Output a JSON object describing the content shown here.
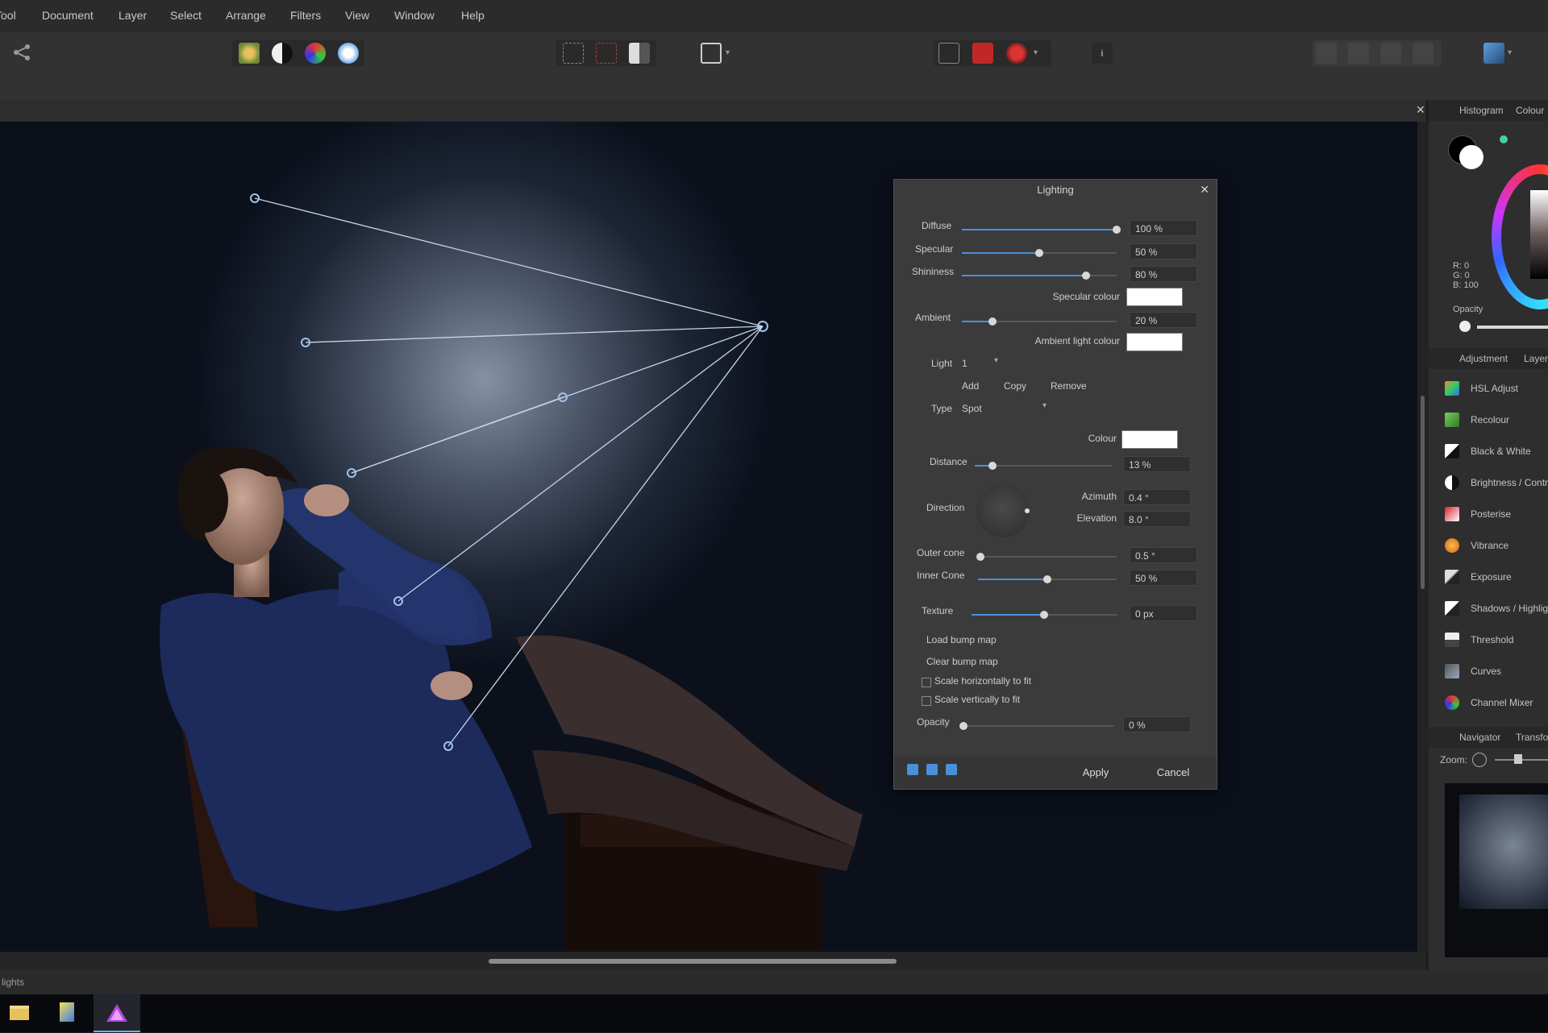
{
  "menu": [
    "Tool",
    "Document",
    "Layer",
    "Select",
    "Arrange",
    "Filters",
    "View",
    "Window",
    "Help"
  ],
  "status_text": "lights",
  "right_panel": {
    "top_tabs": [
      "Histogram",
      "Colour"
    ],
    "colour_readout": [
      "R: 0",
      "G: 0",
      "B: 100"
    ],
    "opacity_label": "Opacity",
    "mid_tabs": [
      "Adjustment",
      "Layers"
    ],
    "adjustments": [
      {
        "label": "HSL Adjust",
        "icon": "hsl-icon"
      },
      {
        "label": "Recolour",
        "icon": "recolour-icon"
      },
      {
        "label": "Black & White",
        "icon": "black-white-icon"
      },
      {
        "label": "Brightness / Contrast",
        "icon": "brightness-contrast-icon"
      },
      {
        "label": "Posterise",
        "icon": "posterise-icon"
      },
      {
        "label": "Vibrance",
        "icon": "vibrance-icon"
      },
      {
        "label": "Exposure",
        "icon": "exposure-icon"
      },
      {
        "label": "Shadows / Highlights",
        "icon": "shadows-highlights-icon"
      },
      {
        "label": "Threshold",
        "icon": "threshold-icon"
      },
      {
        "label": "Curves",
        "icon": "curves-icon"
      },
      {
        "label": "Channel Mixer",
        "icon": "channel-mixer-icon"
      }
    ],
    "bottom_tabs": [
      "Navigator",
      "Transform"
    ],
    "zoom_label": "Zoom:"
  },
  "lighting_dialog": {
    "title": "Lighting",
    "diffuse": {
      "label": "Diffuse",
      "value": "100 %",
      "level": 1.0
    },
    "specular": {
      "label": "Specular",
      "value": "50 %",
      "level": 0.5
    },
    "shininess": {
      "label": "Shininess",
      "value": "80 %",
      "level": 0.8
    },
    "specular_colour_label": "Specular colour",
    "ambient": {
      "label": "Ambient",
      "value": "20 %",
      "level": 0.2
    },
    "ambient_light_colour_label": "Ambient light colour",
    "light_label": "Light",
    "light_value": "1",
    "add_label": "Add",
    "copy_label": "Copy",
    "remove_label": "Remove",
    "type_label": "Type",
    "type_value": "Spot",
    "colour_label": "Colour",
    "distance": {
      "label": "Distance",
      "value": "13 %",
      "level": 0.13
    },
    "direction_label": "Direction",
    "azimuth": {
      "label": "Azimuth",
      "value": "0.4 °"
    },
    "elevation": {
      "label": "Elevation",
      "value": "8.0 °"
    },
    "outer_cone": {
      "label": "Outer cone",
      "value": "0.5 °",
      "level": 0.02
    },
    "inner_cone": {
      "label": "Inner Cone",
      "value": "50 %",
      "level": 0.5
    },
    "texture": {
      "label": "Texture",
      "value": "0 px",
      "level": 0.5
    },
    "load_bump_label": "Load bump map",
    "clear_bump_label": "Clear bump map",
    "scale_h_label": "Scale horizontally to fit",
    "scale_v_label": "Scale vertically to fit",
    "opacity": {
      "label": "Opacity",
      "value": "0 %",
      "level": 0.0
    },
    "apply_label": "Apply",
    "cancel_label": "Cancel"
  },
  "colors": {
    "accent": "#4a90d9",
    "canvas_bg": "#0b101b",
    "dialog_bg": "#3b3b3c"
  }
}
